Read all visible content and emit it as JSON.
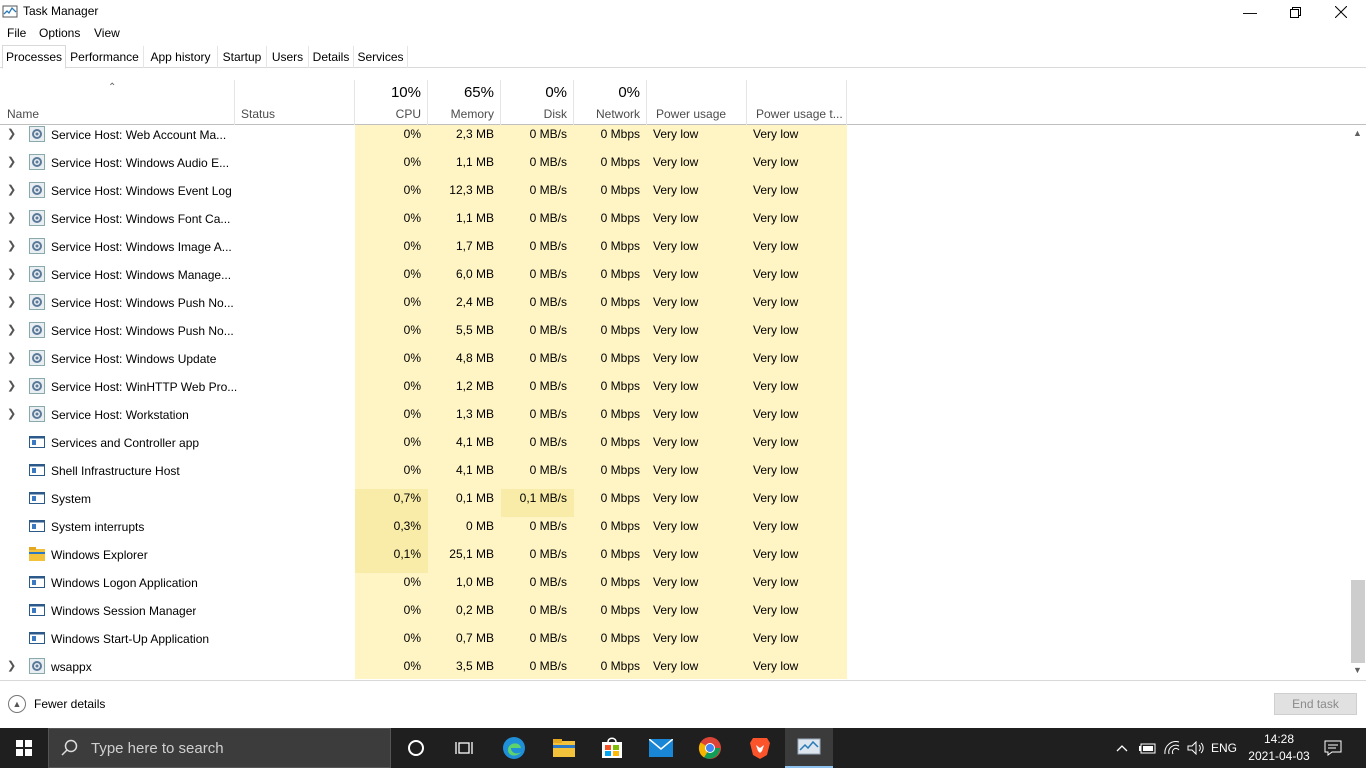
{
  "window": {
    "title": "Task Manager"
  },
  "menu": [
    "File",
    "Options",
    "View"
  ],
  "tabs": [
    "Processes",
    "Performance",
    "App history",
    "Startup",
    "Users",
    "Details",
    "Services"
  ],
  "columns": {
    "name": "Name",
    "status": "Status",
    "cpu": {
      "pct": "10%",
      "label": "CPU"
    },
    "memory": {
      "pct": "65%",
      "label": "Memory"
    },
    "disk": {
      "pct": "0%",
      "label": "Disk"
    },
    "network": {
      "pct": "0%",
      "label": "Network"
    },
    "power": "Power usage",
    "power_trend": "Power usage t..."
  },
  "rows": [
    {
      "name": "Service Host: Web Account Ma...",
      "expand": true,
      "icon": "gear-icon",
      "cpu": "0%",
      "memory": "2,3 MB",
      "disk": "0 MB/s",
      "network": "0 Mbps",
      "power": "Very low",
      "power_trend": "Very low"
    },
    {
      "name": "Service Host: Windows Audio E...",
      "expand": true,
      "icon": "gear-icon",
      "cpu": "0%",
      "memory": "1,1 MB",
      "disk": "0 MB/s",
      "network": "0 Mbps",
      "power": "Very low",
      "power_trend": "Very low"
    },
    {
      "name": "Service Host: Windows Event Log",
      "expand": true,
      "icon": "gear-icon",
      "cpu": "0%",
      "memory": "12,3 MB",
      "disk": "0 MB/s",
      "network": "0 Mbps",
      "power": "Very low",
      "power_trend": "Very low"
    },
    {
      "name": "Service Host: Windows Font Ca...",
      "expand": true,
      "icon": "gear-icon",
      "cpu": "0%",
      "memory": "1,1 MB",
      "disk": "0 MB/s",
      "network": "0 Mbps",
      "power": "Very low",
      "power_trend": "Very low"
    },
    {
      "name": "Service Host: Windows Image A...",
      "expand": true,
      "icon": "gear-icon",
      "cpu": "0%",
      "memory": "1,7 MB",
      "disk": "0 MB/s",
      "network": "0 Mbps",
      "power": "Very low",
      "power_trend": "Very low"
    },
    {
      "name": "Service Host: Windows Manage...",
      "expand": true,
      "icon": "gear-icon",
      "cpu": "0%",
      "memory": "6,0 MB",
      "disk": "0 MB/s",
      "network": "0 Mbps",
      "power": "Very low",
      "power_trend": "Very low"
    },
    {
      "name": "Service Host: Windows Push No...",
      "expand": true,
      "icon": "gear-icon",
      "cpu": "0%",
      "memory": "2,4 MB",
      "disk": "0 MB/s",
      "network": "0 Mbps",
      "power": "Very low",
      "power_trend": "Very low"
    },
    {
      "name": "Service Host: Windows Push No...",
      "expand": true,
      "icon": "gear-icon",
      "cpu": "0%",
      "memory": "5,5 MB",
      "disk": "0 MB/s",
      "network": "0 Mbps",
      "power": "Very low",
      "power_trend": "Very low"
    },
    {
      "name": "Service Host: Windows Update",
      "expand": true,
      "icon": "gear-icon",
      "cpu": "0%",
      "memory": "4,8 MB",
      "disk": "0 MB/s",
      "network": "0 Mbps",
      "power": "Very low",
      "power_trend": "Very low"
    },
    {
      "name": "Service Host: WinHTTP Web Pro...",
      "expand": true,
      "icon": "gear-icon",
      "cpu": "0%",
      "memory": "1,2 MB",
      "disk": "0 MB/s",
      "network": "0 Mbps",
      "power": "Very low",
      "power_trend": "Very low"
    },
    {
      "name": "Service Host: Workstation",
      "expand": true,
      "icon": "gear-icon",
      "cpu": "0%",
      "memory": "1,3 MB",
      "disk": "0 MB/s",
      "network": "0 Mbps",
      "power": "Very low",
      "power_trend": "Very low"
    },
    {
      "name": "Services and Controller app",
      "expand": false,
      "icon": "app-window-icon",
      "cpu": "0%",
      "memory": "4,1 MB",
      "disk": "0 MB/s",
      "network": "0 Mbps",
      "power": "Very low",
      "power_trend": "Very low"
    },
    {
      "name": "Shell Infrastructure Host",
      "expand": false,
      "icon": "app-window-icon",
      "cpu": "0%",
      "memory": "4,1 MB",
      "disk": "0 MB/s",
      "network": "0 Mbps",
      "power": "Very low",
      "power_trend": "Very low"
    },
    {
      "name": "System",
      "expand": false,
      "icon": "app-window-icon",
      "cpu": "0,7%",
      "memory": "0,1 MB",
      "disk": "0,1 MB/s",
      "network": "0 Mbps",
      "power": "Very low",
      "power_trend": "Very low",
      "hl_cpu": true,
      "hl_disk": true
    },
    {
      "name": "System interrupts",
      "expand": false,
      "icon": "app-window-icon",
      "cpu": "0,3%",
      "memory": "0 MB",
      "disk": "0 MB/s",
      "network": "0 Mbps",
      "power": "Very low",
      "power_trend": "Very low",
      "hl_cpu": true
    },
    {
      "name": "Windows Explorer",
      "expand": false,
      "icon": "folder-icon",
      "cpu": "0,1%",
      "memory": "25,1 MB",
      "disk": "0 MB/s",
      "network": "0 Mbps",
      "power": "Very low",
      "power_trend": "Very low",
      "hl_cpu": true
    },
    {
      "name": "Windows Logon Application",
      "expand": false,
      "icon": "app-window-icon",
      "cpu": "0%",
      "memory": "1,0 MB",
      "disk": "0 MB/s",
      "network": "0 Mbps",
      "power": "Very low",
      "power_trend": "Very low"
    },
    {
      "name": "Windows Session Manager",
      "expand": false,
      "icon": "app-window-icon",
      "cpu": "0%",
      "memory": "0,2 MB",
      "disk": "0 MB/s",
      "network": "0 Mbps",
      "power": "Very low",
      "power_trend": "Very low"
    },
    {
      "name": "Windows Start-Up Application",
      "expand": false,
      "icon": "app-window-icon",
      "cpu": "0%",
      "memory": "0,7 MB",
      "disk": "0 MB/s",
      "network": "0 Mbps",
      "power": "Very low",
      "power_trend": "Very low"
    },
    {
      "name": "wsappx",
      "expand": true,
      "icon": "gear-icon",
      "cpu": "0%",
      "memory": "3,5 MB",
      "disk": "0 MB/s",
      "network": "0 Mbps",
      "power": "Very low",
      "power_trend": "Very low"
    }
  ],
  "footer": {
    "fewer_details": "Fewer details",
    "end_task": "End task"
  },
  "taskbar": {
    "search_placeholder": "Type here to search",
    "language": "ENG",
    "time": "14:28",
    "date": "2021-04-03"
  },
  "colors": {
    "cpu_bg": "#fff4c4",
    "highlight_bg": "#f9eca8",
    "taskbar": "#1f1f1f"
  }
}
